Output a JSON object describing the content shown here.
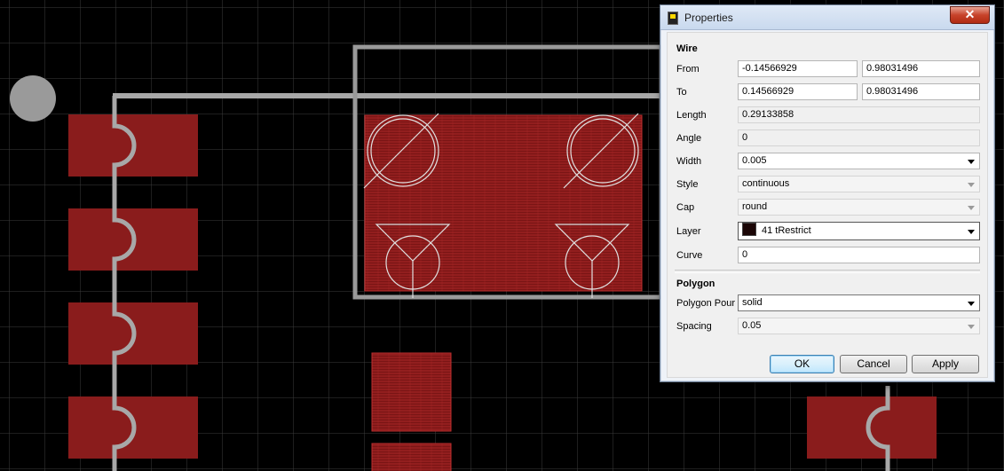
{
  "window": {
    "title": "Properties",
    "close_glyph": "✕"
  },
  "wire": {
    "section_label": "Wire",
    "from": {
      "label": "From",
      "x": "-0.14566929",
      "y": "0.98031496"
    },
    "to": {
      "label": "To",
      "x": "0.14566929",
      "y": "0.98031496"
    },
    "length": {
      "label": "Length",
      "value": "0.29133858"
    },
    "angle": {
      "label": "Angle",
      "value": "0"
    },
    "width": {
      "label": "Width",
      "value": "0.005"
    },
    "style": {
      "label": "Style",
      "value": "continuous"
    },
    "cap": {
      "label": "Cap",
      "value": "round"
    },
    "layer": {
      "label": "Layer",
      "value": "41 tRestrict",
      "color": "#1b0606"
    },
    "curve": {
      "label": "Curve",
      "value": "0"
    }
  },
  "polygon": {
    "section_label": "Polygon",
    "pour": {
      "label": "Polygon Pour",
      "value": "solid"
    },
    "spacing": {
      "label": "Spacing",
      "value": "0.05"
    }
  },
  "buttons": {
    "ok": "OK",
    "cancel": "Cancel",
    "apply": "Apply"
  },
  "colors": {
    "pad": "#8a1c1c",
    "restrict_fill": "#7a1515",
    "wire": "#a8a8a8",
    "grid": "#3c3c3c",
    "background": "#000000"
  },
  "icons": {
    "close": "close-icon",
    "app": "properties-window-icon",
    "dropdown": "chevron-down-icon"
  }
}
